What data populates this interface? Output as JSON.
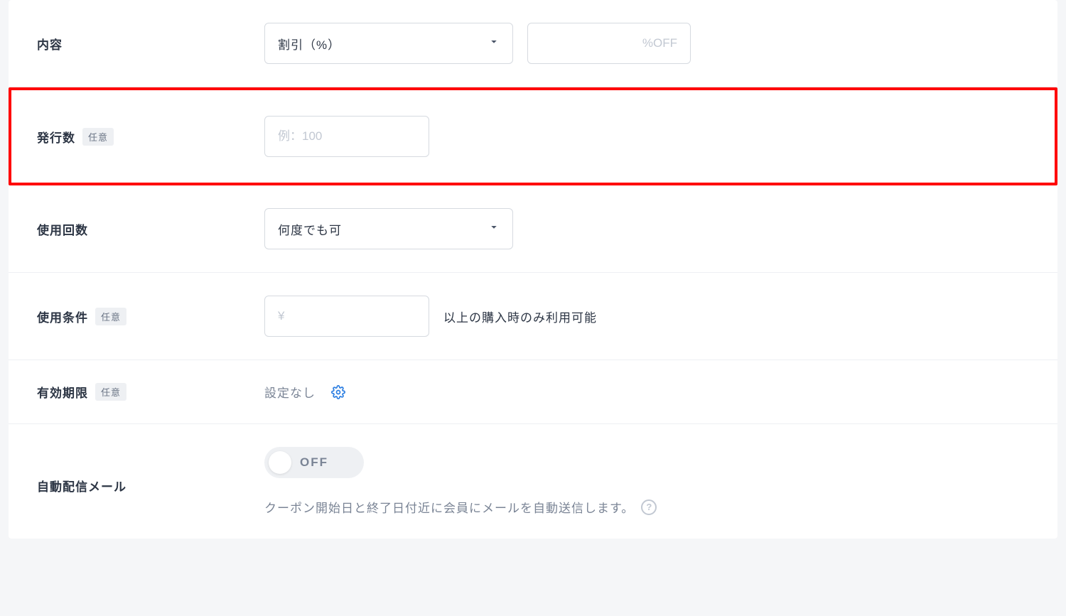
{
  "fields": {
    "content": {
      "label": "内容",
      "select_value": "割引（%）",
      "percent_placeholder": "%OFF"
    },
    "issue_count": {
      "label": "発行数",
      "optional_badge": "任意",
      "placeholder": "例：100"
    },
    "usage_count": {
      "label": "使用回数",
      "select_value": "何度でも可"
    },
    "usage_condition": {
      "label": "使用条件",
      "optional_badge": "任意",
      "placeholder": "¥",
      "suffix": "以上の購入時のみ利用可能"
    },
    "expiry": {
      "label": "有効期限",
      "optional_badge": "任意",
      "value": "設定なし"
    },
    "auto_mail": {
      "label": "自動配信メール",
      "toggle_label": "OFF",
      "help_text": "クーポン開始日と終了日付近に会員にメールを自動送信します。"
    }
  }
}
